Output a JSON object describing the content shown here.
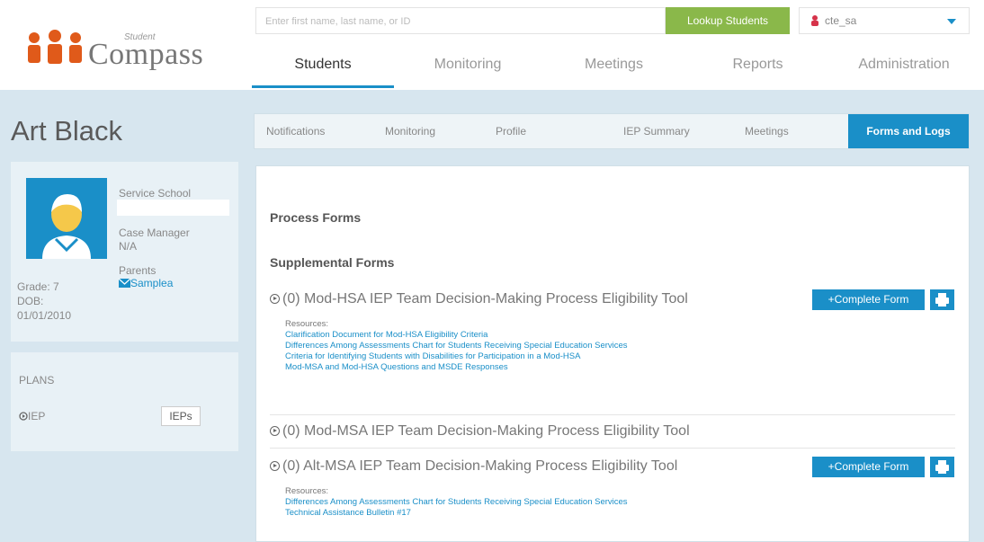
{
  "header": {
    "logo_small": "Student",
    "logo_big": "Compass",
    "search_placeholder": "Enter first name, last name, or ID",
    "lookup_label": "Lookup Students",
    "user_name": "cte_sa"
  },
  "main_nav": [
    {
      "label": "Students",
      "active": true
    },
    {
      "label": "Monitoring",
      "active": false
    },
    {
      "label": "Meetings",
      "active": false
    },
    {
      "label": "Reports",
      "active": false
    },
    {
      "label": "Administration",
      "active": false
    }
  ],
  "student": {
    "name": "Art Black",
    "service_school_label": "Service School",
    "case_manager_label": "Case Manager",
    "case_manager_value": "N/A",
    "parents_label": "Parents",
    "parent_name": "Samplea",
    "grade": "Grade: 7",
    "dob_label": "DOB:",
    "dob": "01/01/2010"
  },
  "plans": {
    "heading": "PLANS",
    "item": "IEP",
    "button": "IEPs"
  },
  "sub_nav": [
    {
      "label": "Notifications",
      "active": false
    },
    {
      "label": "Monitoring",
      "active": false
    },
    {
      "label": "Profile",
      "active": false
    },
    {
      "label": "IEP Summary",
      "active": false
    },
    {
      "label": "Meetings",
      "active": false
    },
    {
      "label": "Forms and Logs",
      "active": true
    }
  ],
  "content": {
    "process_heading": "Process Forms",
    "supplemental_heading": "Supplemental Forms",
    "resources_label": "Resources:",
    "complete_label": "+Complete Form",
    "forms": [
      {
        "title": "(0) Mod-HSA IEP Team Decision-Making Process Eligibility Tool",
        "resources": [
          "Clarification Document for Mod-HSA Eligibility Criteria",
          "Differences Among Assessments Chart for Students Receiving Special Education Services",
          "Criteria for Identifying Students with Disabilities for Participation in a Mod-HSA",
          "Mod-MSA and Mod-HSA Questions and MSDE Responses"
        ]
      },
      {
        "title": "(0) Mod-MSA IEP Team Decision-Making Process Eligibility Tool",
        "resources": []
      },
      {
        "title": "(0) Alt-MSA IEP Team Decision-Making Process Eligibility Tool",
        "resources": [
          "Differences Among Assessments Chart for Students Receiving Special Education Services",
          "Technical Assistance Bulletin #17"
        ]
      }
    ]
  },
  "colors": {
    "accent": "#1a8fc8",
    "lookup_green": "#8ab84a",
    "background": "#d7e6ef"
  }
}
